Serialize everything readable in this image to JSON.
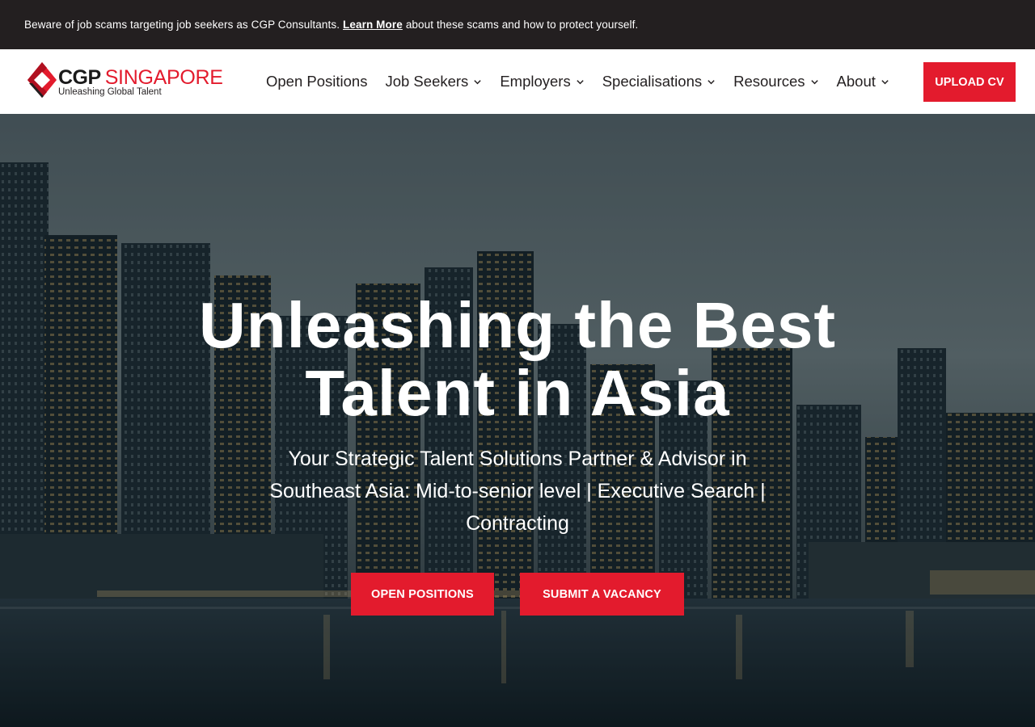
{
  "alert": {
    "text_before": "Beware of job scams targeting job seekers as CGP Consultants.",
    "link_text": "Learn More",
    "text_after": "about these scams and how to protect yourself."
  },
  "logo": {
    "brand": "CGP",
    "region": "SINGAPORE",
    "tagline": "Unleashing Global Talent",
    "icon": "cgp-diamond-logo-icon"
  },
  "nav": {
    "items": [
      {
        "label": "Open Positions",
        "has_dropdown": false
      },
      {
        "label": "Job Seekers",
        "has_dropdown": true
      },
      {
        "label": "Employers",
        "has_dropdown": true
      },
      {
        "label": "Specialisations",
        "has_dropdown": true
      },
      {
        "label": "Resources",
        "has_dropdown": true
      },
      {
        "label": "About",
        "has_dropdown": true
      }
    ],
    "dropdown_icon": "chevron-down-icon",
    "cta_label": "UPLOAD CV"
  },
  "hero": {
    "title_line1": "Unleashing the Best",
    "title_line2": "Talent in Asia",
    "subtitle": "Your Strategic Talent Solutions Partner & Advisor in Southeast Asia: Mid-to-senior level | Executive Search | Contracting",
    "buttons": {
      "open_positions": "OPEN POSITIONS",
      "submit_vacancy": "SUBMIT A VACANCY"
    },
    "background": "singapore-skyline-at-dusk"
  },
  "colors": {
    "accent": "#e31b2d",
    "alert_bg": "#231f20",
    "header_bg": "#ffffff",
    "nav_text": "#231f20"
  }
}
